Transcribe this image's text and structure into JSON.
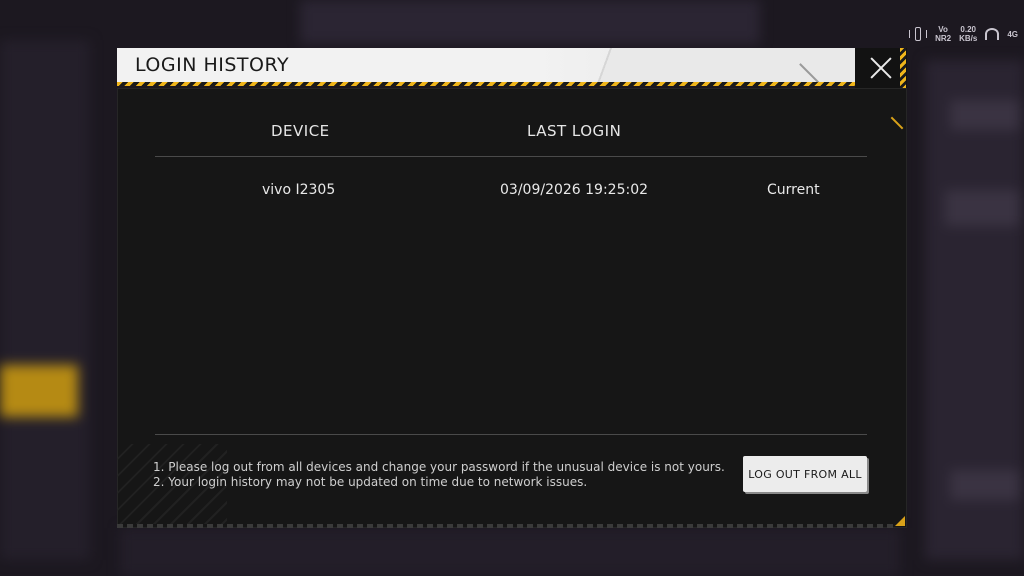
{
  "status_bar": {
    "net_top": "Vo",
    "net_bottom": "NR2",
    "speed_top": "0.20",
    "speed_bottom": "KB/s",
    "network_type": "4G"
  },
  "dialog": {
    "title": "LOGIN HISTORY",
    "columns": {
      "device": "DEVICE",
      "last_login": "LAST LOGIN"
    },
    "rows": [
      {
        "device": "vivo I2305",
        "last_login": "03/09/2026 19:25:02",
        "status": "Current"
      }
    ],
    "notes": [
      "1. Please log out from all devices and change your password if the unusual device is not yours.",
      "2. Your login history may not be updated on time due to network issues."
    ],
    "logout_all_label": "LOG OUT FROM ALL"
  },
  "colors": {
    "accent": "#f0b51a",
    "header_bg": "#f2f2f2",
    "body_bg": "#161616"
  }
}
